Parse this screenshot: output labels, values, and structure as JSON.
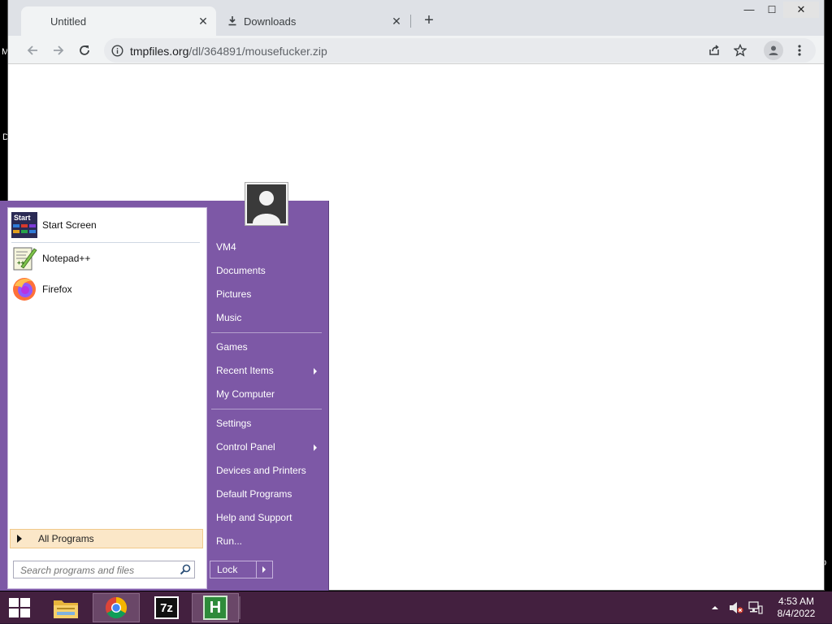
{
  "desktop": {
    "stray_chars": [
      "M",
      "D",
      "M",
      "D",
      "D"
    ]
  },
  "browser": {
    "tabs": [
      {
        "label": "Untitled",
        "active": true
      },
      {
        "label": "Downloads",
        "active": false
      }
    ],
    "url": {
      "domain": "tmpfiles.org",
      "path": "/dl/364891/mousefucker.zip"
    },
    "window_controls": {
      "minimize": "—",
      "maximize": "☐",
      "close": "✕"
    }
  },
  "start_menu": {
    "pinned": [
      {
        "label": "Start Screen",
        "icon": "start-screen-icon",
        "icon_text": "Start"
      },
      {
        "label": "Notepad++",
        "icon": "notepadpp-icon"
      },
      {
        "label": "Firefox",
        "icon": "firefox-icon"
      }
    ],
    "all_programs": "All Programs",
    "search_placeholder": "Search programs and files",
    "right_items": [
      {
        "label": "VM4"
      },
      {
        "label": "Documents"
      },
      {
        "label": "Pictures"
      },
      {
        "label": "Music"
      },
      {
        "label": "Games"
      },
      {
        "label": "Recent Items",
        "submenu": true
      },
      {
        "label": "My Computer"
      },
      {
        "label": "Settings"
      },
      {
        "label": "Control Panel",
        "submenu": true
      },
      {
        "label": "Devices and Printers"
      },
      {
        "label": "Default Programs"
      },
      {
        "label": "Help and Support"
      },
      {
        "label": "Run..."
      }
    ],
    "lock": "Lock",
    "colors": {
      "panel": "#7d58a6",
      "all_programs_bg": "#fbe7c8"
    }
  },
  "taskbar": {
    "apps": [
      "start-button",
      "file-explorer-icon",
      "chrome-icon",
      "7zip-icon",
      "hxd-icon"
    ],
    "seven_zip_label": "7z",
    "hxd_label": "H",
    "clock": {
      "time": "4:53 AM",
      "date": "8/4/2022"
    },
    "color": "#43203f"
  }
}
